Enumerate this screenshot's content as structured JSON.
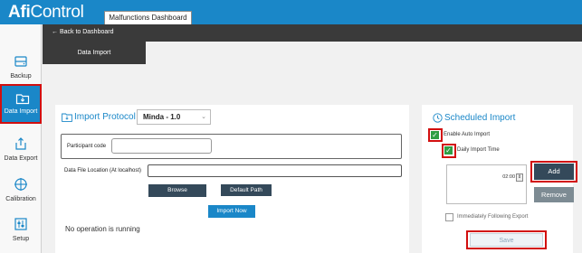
{
  "app": {
    "logo_bold": "Afi",
    "logo_rest": "Control",
    "dashboard_tab": "Malfunctions Dashboard"
  },
  "sidebar": {
    "items": [
      {
        "label": "Backup",
        "icon": "backup-icon"
      },
      {
        "label": "Data Import",
        "icon": "import-folder-icon",
        "active": true
      },
      {
        "label": "Data Export",
        "icon": "export-icon"
      },
      {
        "label": "Calibration",
        "icon": "crosshair-icon"
      },
      {
        "label": "Setup",
        "icon": "setup-icon"
      }
    ]
  },
  "nav": {
    "back_label": "← Back to Dashboard",
    "tab_label": "Data Import"
  },
  "import_protocol": {
    "title": "Import Protocol",
    "protocol_value": "Minda - 1.0",
    "participant_label": "Participant code",
    "participant_value": "",
    "file_location_label": "Data File Location (At localhost)",
    "file_location_value": "",
    "browse_label": "Browse",
    "default_path_label": "Default Path",
    "import_now_label": "Import Now",
    "status_text": "No operation is running"
  },
  "scheduled_import": {
    "title": "Scheduled Import",
    "enable_auto_label": "Enable Auto Import",
    "enable_auto_checked": true,
    "daily_time_label": "Daily Import Time",
    "daily_time_checked": true,
    "time_value": "02:00",
    "add_label": "Add",
    "remove_label": "Remove",
    "following_export_label": "Immediately Following Export",
    "following_export_checked": false,
    "save_label": "Save"
  },
  "colors": {
    "brand": "#1a87c8",
    "dark": "#3a3a3a",
    "button_dark": "#34495a",
    "highlight": "#d20f0f",
    "check": "#2f9e44"
  }
}
